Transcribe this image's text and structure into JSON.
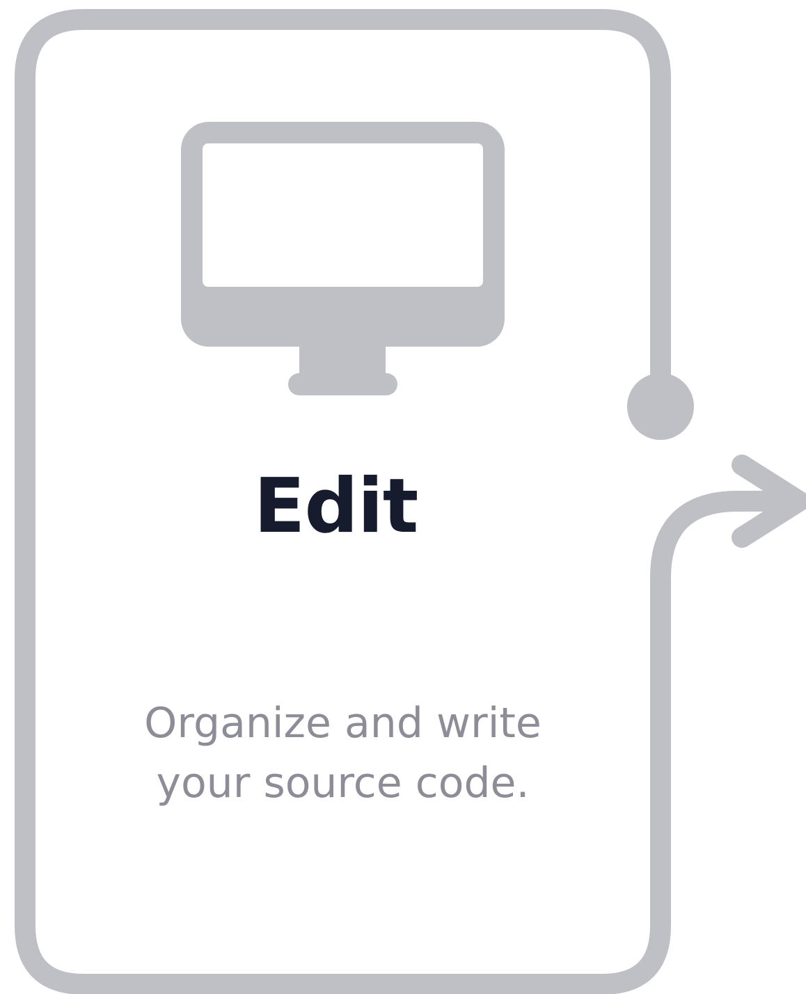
{
  "step": {
    "title": "Edit",
    "description_lines": [
      "Organize and write",
      "your source code."
    ],
    "icon": "monitor-icon"
  },
  "colors": {
    "stroke": "#bfbfc6",
    "title": "#171b2e",
    "description": "#8d8d98",
    "background": "#ffffff"
  }
}
